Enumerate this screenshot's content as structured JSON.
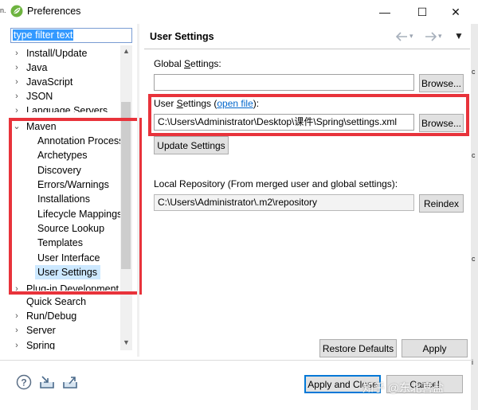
{
  "window": {
    "title": "Preferences",
    "minimize": "—",
    "maximize": "☐",
    "close": "✕",
    "edge_glyph": "n."
  },
  "colors": {
    "highlight": "#e8333b",
    "selection": "#cce8ff",
    "link": "#0066cc",
    "accent": "#0078d7"
  },
  "filter": {
    "value": "type filter text"
  },
  "tree": {
    "items": [
      {
        "label": "Install/Update",
        "expander": "›"
      },
      {
        "label": "Java",
        "expander": "›"
      },
      {
        "label": "JavaScript",
        "expander": "›"
      },
      {
        "label": "JSON",
        "expander": "›"
      },
      {
        "label": "Language Servers",
        "expander": "›"
      },
      {
        "label": "Maven",
        "expander": "⌄"
      },
      {
        "label": "Annotation Process"
      },
      {
        "label": "Archetypes"
      },
      {
        "label": "Discovery"
      },
      {
        "label": "Errors/Warnings"
      },
      {
        "label": "Installations"
      },
      {
        "label": "Lifecycle Mappings"
      },
      {
        "label": "Source Lookup"
      },
      {
        "label": "Templates"
      },
      {
        "label": "User Interface"
      },
      {
        "label": "User Settings",
        "selected": true
      },
      {
        "label": "Plug-in Development",
        "expander": "›"
      },
      {
        "label": "Quick Search"
      },
      {
        "label": "Run/Debug",
        "expander": "›"
      },
      {
        "label": "Server",
        "expander": "›"
      },
      {
        "label": "Spring",
        "expander": "›"
      }
    ]
  },
  "page": {
    "title": "User Settings",
    "global": {
      "label_pre": "Global ",
      "label_u": "S",
      "label_post": "ettings:",
      "value": "",
      "browse": "Browse..."
    },
    "user": {
      "label_pre": "User ",
      "label_u": "S",
      "label_post": "ettings (",
      "link": "open file",
      "label_end": "):",
      "value": "C:\\Users\\Administrator\\Desktop\\课件\\Spring\\settings.xml",
      "browse": "Browse..."
    },
    "update_button": "Update Settings",
    "local_repo": {
      "label": "Local Repository (From merged user and global settings):",
      "value": "C:\\Users\\Administrator\\.m2\\repository",
      "reindex": "Reindex"
    },
    "restore_defaults": "Restore Defaults",
    "apply": "Apply"
  },
  "footer": {
    "apply_and_close": "Apply and Close",
    "cancel": "Cancel"
  },
  "watermark": "知乎 @东北喜盐"
}
